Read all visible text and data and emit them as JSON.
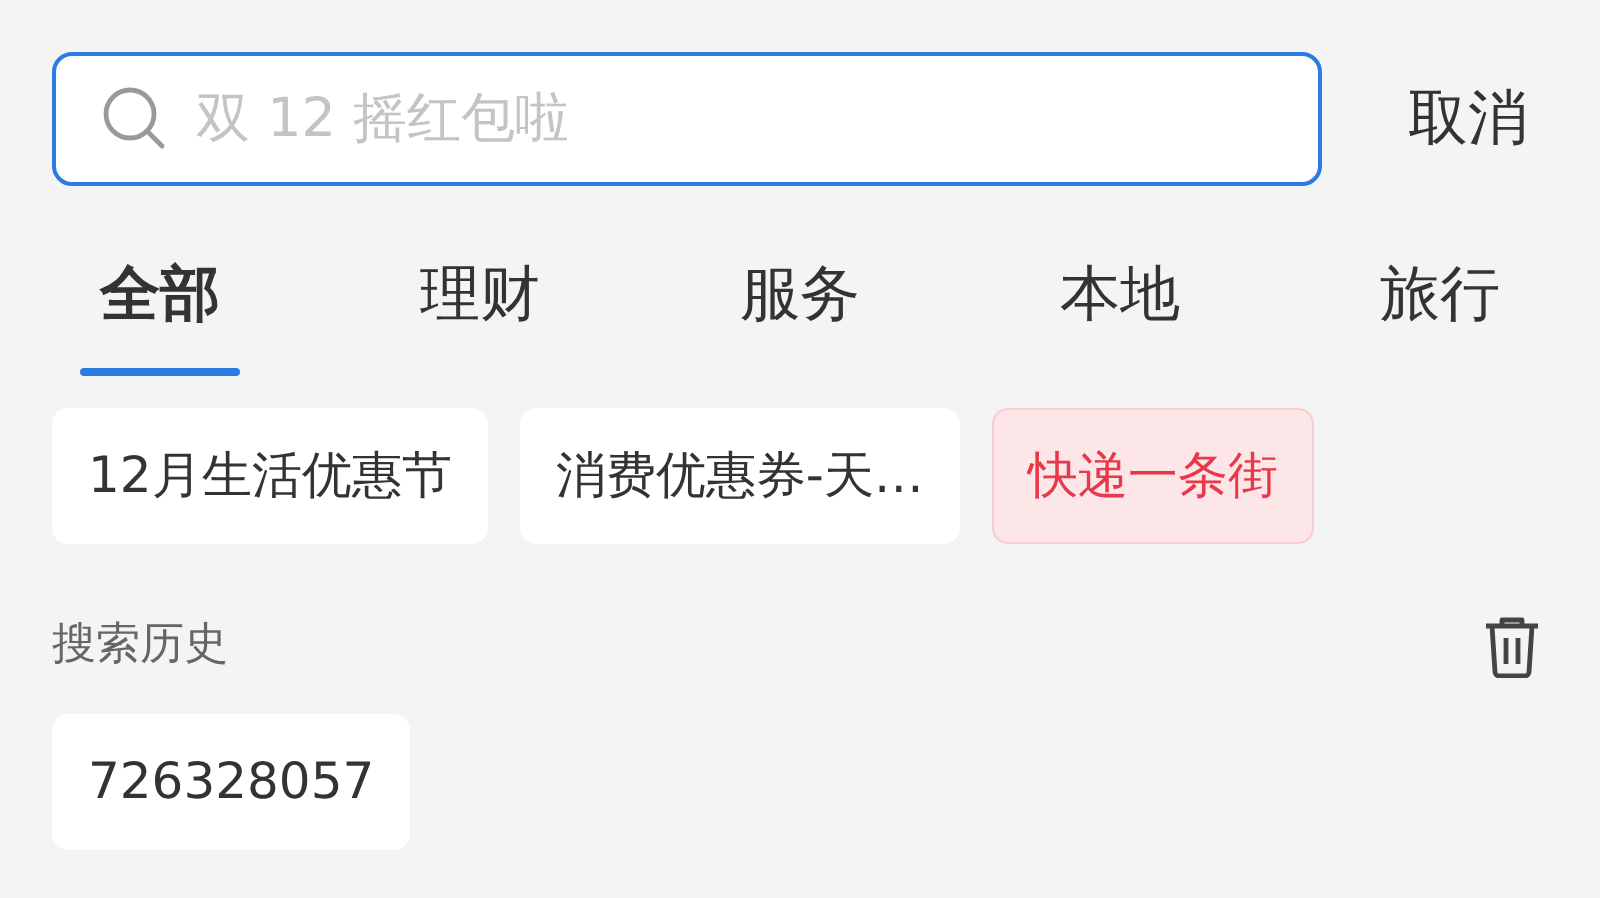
{
  "search": {
    "placeholder": "双 12 摇红包啦"
  },
  "cancel": "取消",
  "tabs": [
    {
      "label": "全部",
      "selected": true
    },
    {
      "label": "理财",
      "selected": false
    },
    {
      "label": "服务",
      "selected": false
    },
    {
      "label": "本地",
      "selected": false
    },
    {
      "label": "旅行",
      "selected": false
    }
  ],
  "suggestions": [
    {
      "label": "12月生活优惠节",
      "highlighted": false
    },
    {
      "label": "消费优惠券-天…",
      "highlighted": false
    },
    {
      "label": "快递一条街",
      "highlighted": true
    }
  ],
  "history": {
    "title": "搜索历史",
    "items": [
      "726328057"
    ]
  }
}
